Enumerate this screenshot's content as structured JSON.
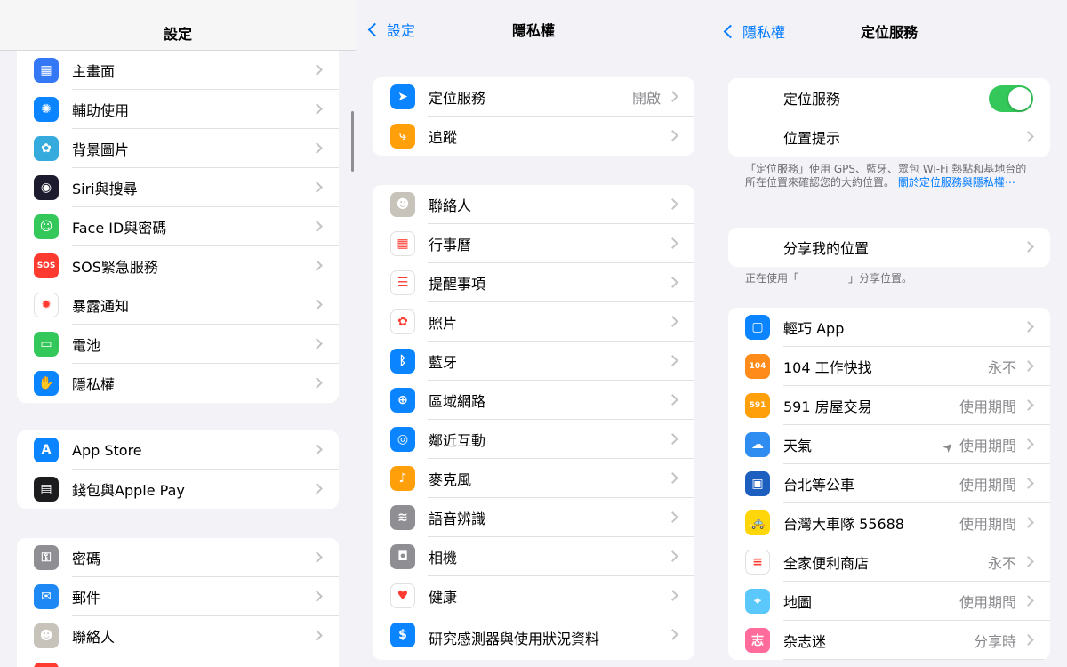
{
  "pane1": {
    "title": "設定",
    "groups": [
      [
        {
          "label": "主畫面",
          "icon": "home-screen-icon",
          "color": "#3478f6",
          "glyph": "▦"
        },
        {
          "label": "輔助使用",
          "icon": "accessibility-icon",
          "color": "#0a84ff",
          "glyph": "✺"
        },
        {
          "label": "背景圖片",
          "icon": "wallpaper-icon",
          "color": "#35aadc",
          "glyph": "✿"
        },
        {
          "label": "Siri與搜尋",
          "icon": "siri-icon",
          "color": "#1c1c2e",
          "glyph": "◉"
        },
        {
          "label": "Face ID與密碼",
          "icon": "face-id-icon",
          "color": "#34c759",
          "glyph": "☺"
        },
        {
          "label": "SOS緊急服務",
          "icon": "sos-icon",
          "color": "#ff3b30",
          "glyph": "SOS"
        },
        {
          "label": "暴露通知",
          "icon": "exposure-notification-icon",
          "color": "#ffffff",
          "glyph": "✹"
        },
        {
          "label": "電池",
          "icon": "battery-icon",
          "color": "#34c759",
          "glyph": "▭"
        },
        {
          "label": "隱私權",
          "icon": "privacy-hand-icon",
          "color": "#0a84ff",
          "glyph": "✋"
        }
      ],
      [
        {
          "label": "App Store",
          "icon": "app-store-icon",
          "color": "#0a84ff",
          "glyph": "A"
        },
        {
          "label": "錢包與Apple Pay",
          "icon": "wallet-icon",
          "color": "#1c1c1e",
          "glyph": "▤"
        }
      ],
      [
        {
          "label": "密碼",
          "icon": "key-icon",
          "color": "#8e8e93",
          "glyph": "⚿"
        },
        {
          "label": "郵件",
          "icon": "mail-icon",
          "color": "#1e88f5",
          "glyph": "✉"
        },
        {
          "label": "聯絡人",
          "icon": "contacts-icon",
          "color": "#c7c2ba",
          "glyph": "☻"
        },
        {
          "label": "",
          "icon": "calendar-icon",
          "color": "#ff3b30",
          "glyph": ""
        }
      ]
    ]
  },
  "pane2": {
    "title": "隱私權",
    "back": "設定",
    "groups": [
      [
        {
          "label": "定位服務",
          "value": "開啟",
          "icon": "location-arrow-icon",
          "color": "#0a84ff",
          "glyph": "➤"
        },
        {
          "label": "追蹤",
          "icon": "tracking-icon",
          "color": "#ff9f0a",
          "glyph": "⤷"
        }
      ],
      [
        {
          "label": "聯絡人",
          "icon": "contacts-icon",
          "color": "#c7c2ba",
          "glyph": "☻"
        },
        {
          "label": "行事曆",
          "icon": "calendar-icon",
          "color": "#ffffff",
          "glyph": "▦"
        },
        {
          "label": "提醒事項",
          "icon": "reminders-icon",
          "color": "#ffffff",
          "glyph": "☰"
        },
        {
          "label": "照片",
          "icon": "photos-icon",
          "color": "#ffffff",
          "glyph": "✿"
        },
        {
          "label": "藍牙",
          "icon": "bluetooth-icon",
          "color": "#0a84ff",
          "glyph": "ᛒ"
        },
        {
          "label": "區域網路",
          "icon": "local-network-icon",
          "color": "#0a84ff",
          "glyph": "⊕"
        },
        {
          "label": "鄰近互動",
          "icon": "nearby-interactions-icon",
          "color": "#0a84ff",
          "glyph": "◎"
        },
        {
          "label": "麥克風",
          "icon": "microphone-icon",
          "color": "#ff9f0a",
          "glyph": "♪"
        },
        {
          "label": "語音辨識",
          "icon": "speech-recognition-icon",
          "color": "#8e8e93",
          "glyph": "≋"
        },
        {
          "label": "相機",
          "icon": "camera-icon",
          "color": "#8e8e93",
          "glyph": "◘"
        },
        {
          "label": "健康",
          "icon": "health-heart-icon",
          "color": "#ffffff",
          "glyph": "♥"
        },
        {
          "label": "研究感測器與使用狀況資料",
          "icon": "research-sensor-icon",
          "color": "#0a84ff",
          "glyph": "$"
        }
      ]
    ]
  },
  "pane3": {
    "title": "定位服務",
    "back": "隱私權",
    "toggle_label": "定位服務",
    "location_alerts_label": "位置提示",
    "footnote_text": "「定位服務」使用 GPS、藍牙、眾包 Wi-Fi 熱點和基地台的所在位置來確認您的大約位置。",
    "footnote_link": "關於定位服務與隱私權⋯",
    "share_label": "分享我的位置",
    "share_note_prefix": "正在使用「",
    "share_note_suffix": "」分享位置。",
    "apps": [
      {
        "label": "輕巧 App",
        "value": "",
        "icon": "assistive-app-icon",
        "color": "#0a84ff",
        "glyph": "▢"
      },
      {
        "label": "104 工作快找",
        "value": "永不",
        "icon": "104-job-icon",
        "color": "#ff8c1a",
        "glyph": "104"
      },
      {
        "label": "591 房屋交易",
        "value": "使用期間",
        "icon": "591-house-icon",
        "color": "#ff9f0a",
        "glyph": "591"
      },
      {
        "label": "天氣",
        "value": "使用期間",
        "icon": "weather-icon",
        "color": "#2f8cf0",
        "glyph": "☁",
        "arrow": true
      },
      {
        "label": "台北等公車",
        "value": "使用期間",
        "icon": "bus-icon",
        "color": "#1d5fbf",
        "glyph": "▣"
      },
      {
        "label": "台灣大車隊 55688",
        "value": "使用期間",
        "icon": "taxi-icon",
        "color": "#ffd60a",
        "glyph": "🚕"
      },
      {
        "label": "全家便利商店",
        "value": "永不",
        "icon": "familymart-icon",
        "color": "#ffffff",
        "glyph": "≡"
      },
      {
        "label": "地圖",
        "value": "使用期間",
        "icon": "maps-icon",
        "color": "#5ac8fa",
        "glyph": "⌖"
      },
      {
        "label": "杂志迷",
        "value": "分享時",
        "icon": "magazine-icon",
        "color": "#ff6b9a",
        "glyph": "志"
      }
    ]
  }
}
